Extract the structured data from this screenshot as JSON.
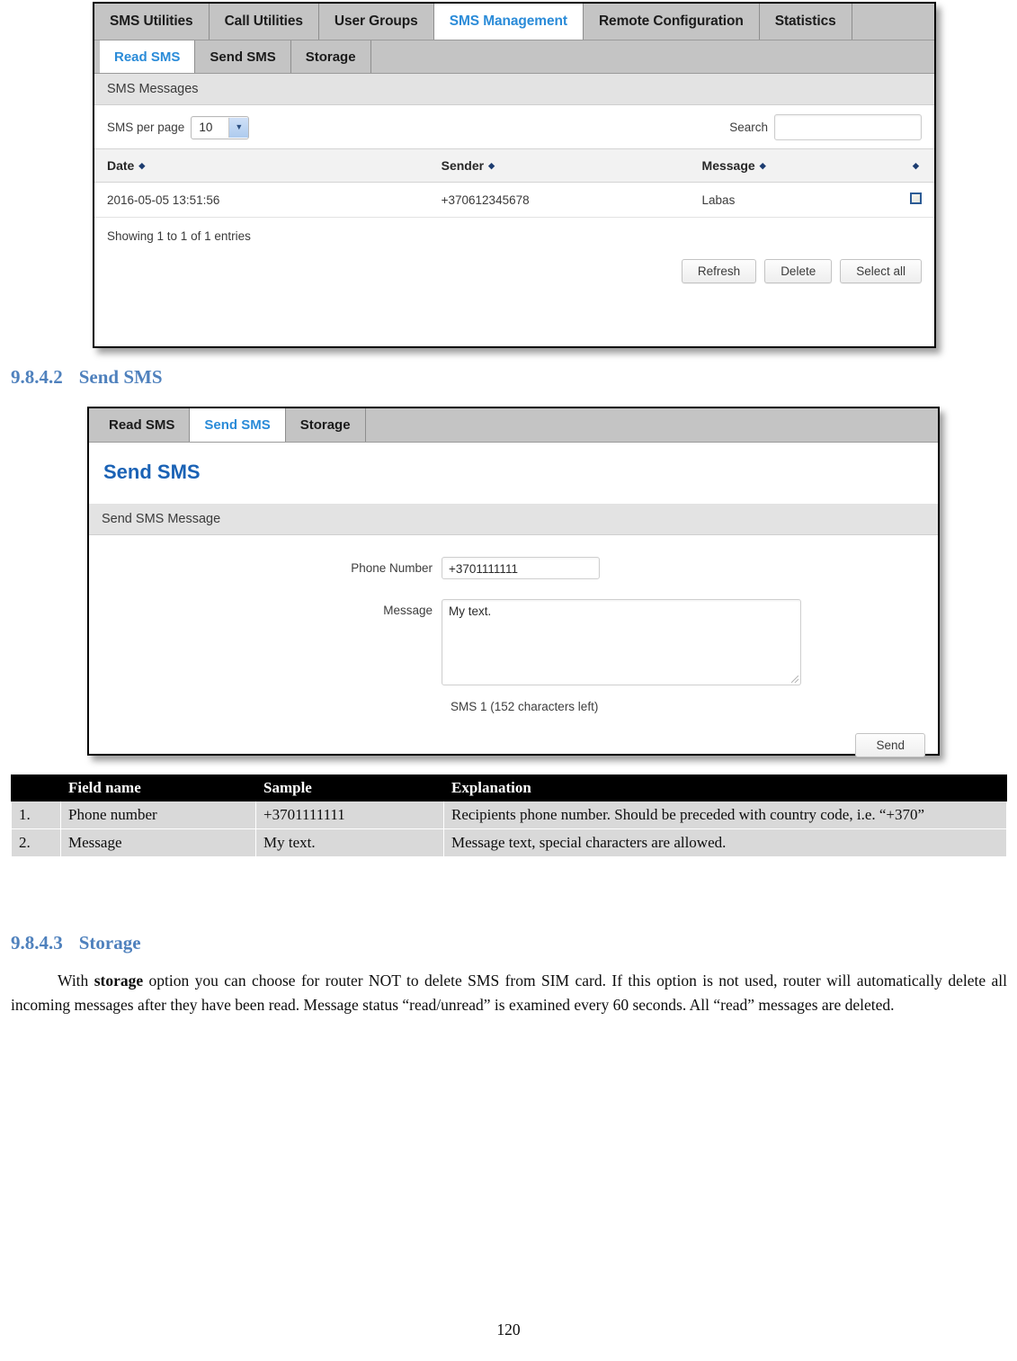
{
  "read_sms_screenshot": {
    "nav_tabs": [
      {
        "label": "SMS Utilities",
        "active": false
      },
      {
        "label": "Call Utilities",
        "active": false
      },
      {
        "label": "User Groups",
        "active": false
      },
      {
        "label": "SMS Management",
        "active": true
      },
      {
        "label": "Remote Configuration",
        "active": false
      },
      {
        "label": "Statistics",
        "active": false
      }
    ],
    "sub_tabs": [
      {
        "label": "Read SMS",
        "active": true
      },
      {
        "label": "Send SMS",
        "active": false
      },
      {
        "label": "Storage",
        "active": false
      }
    ],
    "panel_title": "SMS Messages",
    "per_page_label": "SMS per page",
    "per_page_value": "10",
    "per_page_options": [
      "10"
    ],
    "search_label": "Search",
    "search_value": "",
    "columns": [
      "Date",
      "Sender",
      "Message",
      ""
    ],
    "rows": [
      {
        "date": "2016-05-05 13:51:56",
        "sender": "+370612345678",
        "message": "Labas",
        "selected": false
      }
    ],
    "entries_text": "Showing 1 to 1 of 1 entries",
    "buttons": [
      "Refresh",
      "Delete",
      "Select all"
    ],
    "sort_glyph": "◆"
  },
  "send_sms_screenshot": {
    "sub_tabs": [
      {
        "label": "Read SMS",
        "active": false
      },
      {
        "label": "Send SMS",
        "active": true
      },
      {
        "label": "Storage",
        "active": false
      }
    ],
    "page_heading": "Send SMS",
    "panel_title": "Send SMS Message",
    "phone_label": "Phone Number",
    "phone_value": "+3701111111",
    "message_label": "Message",
    "message_value": "My text.",
    "char_count": "SMS 1 (152 characters left)",
    "send_button": "Send"
  },
  "doc": {
    "section_send": {
      "number": "9.8.4.2",
      "title": "Send SMS"
    },
    "section_storage": {
      "number": "9.8.4.3",
      "title": "Storage"
    },
    "field_table": {
      "headers": [
        "",
        "Field name",
        "Sample",
        "Explanation"
      ],
      "rows": [
        {
          "idx": "1.",
          "field": "Phone number",
          "sample": "+3701111111",
          "explanation": "Recipients phone number. Should be preceded with country code, i.e. “+370”"
        },
        {
          "idx": "2.",
          "field": "Message",
          "sample": "My text.",
          "explanation": "Message text, special characters are allowed."
        }
      ]
    },
    "storage_paragraph": {
      "part1": "With ",
      "bold": "storage",
      "part2": " option you can choose for router NOT to delete SMS from SIM card. If this option is not used, router will automatically delete all incoming messages after they have been read. Message status “read/unread” is examined every 60 seconds. All “read” messages are deleted."
    },
    "page_number": "120"
  }
}
